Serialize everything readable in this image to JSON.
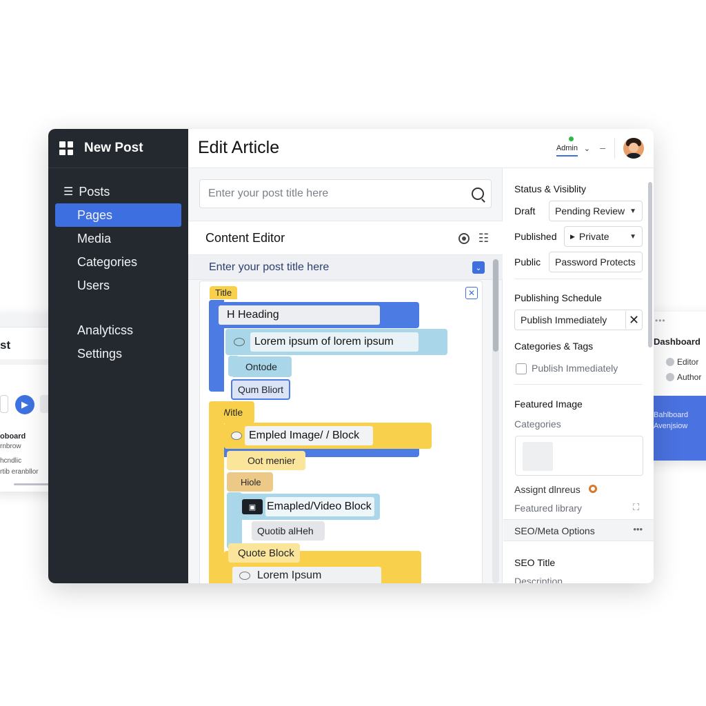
{
  "ghost_left": {
    "title": "st",
    "play_icon": "play-icon",
    "label1": "oboard",
    "label2": "rnbrow",
    "label3": "hcndlic",
    "label4": "rtib eranbllor"
  },
  "ghost_right": {
    "dots": "•••",
    "title": "Dashboard",
    "row1": "Editor",
    "row2": "Author",
    "card1": "Bahlboard",
    "card2": "Avenjsiow"
  },
  "sidebar": {
    "title": "New Post",
    "logo_icon": "grid-logo-icon",
    "items": [
      {
        "label": "Posts"
      },
      {
        "label": "Pages"
      },
      {
        "label": "Media"
      },
      {
        "label": "Categories"
      },
      {
        "label": "Users"
      },
      {
        "label": "Analyticss"
      },
      {
        "label": "Settings"
      }
    ]
  },
  "topbar": {
    "title": "Edit Article",
    "user": "Admin",
    "status_color": "#2db84b",
    "accent": "#3d6fe0"
  },
  "editor": {
    "title_placeholder": "Enter your post title here",
    "content_editor": "Content Editor",
    "subtitle": "Enter your post title here",
    "blocks": {
      "title_tab": "Title",
      "heading": "H  Heading",
      "lorem1": "Lorem ipsum of lorem ipsum",
      "ontode": "Ontode",
      "qum": "Qum Bliort",
      "witle": "Witle",
      "img_block": "Empled Image/ / Block",
      "oot": "Oot menier",
      "hiole": "Hiole",
      "video_block": "Emapled/Video Block",
      "quotib": "Quotib alHeh",
      "quote_block": "Quote Block",
      "lorem2": "Lorem Ipsum"
    }
  },
  "panel": {
    "status_heading": "Status & Visiblity",
    "draft": "Draft",
    "draft_value": "Pending Review",
    "published": "Published",
    "published_value": "Private",
    "public": "Public",
    "public_value": "Password Protects",
    "schedule_heading": "Publishing Schedule",
    "schedule_value": "Publish Immediately",
    "cats_heading": "Categories & Tags",
    "cats_check": "Publish Immediately",
    "featured_heading": "Featured Image",
    "categories": "Categories",
    "assign": "Assignt dlnreus",
    "featured_library": "Featured library",
    "seo_options": "SEO/Meta Options",
    "seo_title": "SEO Title",
    "description": "Description"
  }
}
